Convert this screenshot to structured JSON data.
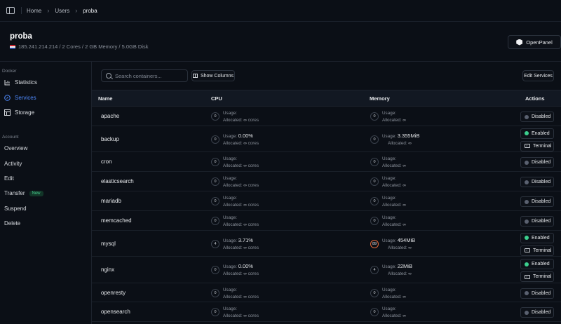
{
  "breadcrumb": [
    "Home",
    "Users",
    "proba"
  ],
  "server": {
    "name": "proba",
    "meta": "185.241.214.214 / 2 Cores / 2 GB Memory / 5.0GB Disk",
    "brand_button": "OpenPanel"
  },
  "sidebar": {
    "docker_section": "Docker",
    "docker_items": [
      {
        "label": "Statistics",
        "icon": "chart-icon"
      },
      {
        "label": "Services",
        "icon": "compass-icon",
        "active": true
      },
      {
        "label": "Storage",
        "icon": "table-icon"
      }
    ],
    "account_section": "Account",
    "account_items": [
      {
        "label": "Overview"
      },
      {
        "label": "Activity"
      },
      {
        "label": "Edit"
      },
      {
        "label": "Transfer",
        "badge": "New"
      },
      {
        "label": "Suspend"
      },
      {
        "label": "Delete"
      }
    ]
  },
  "toolbar": {
    "search_placeholder": "Search containers...",
    "show_columns": "Show Columns",
    "edit_services": "Edit Services"
  },
  "table": {
    "headers": {
      "name": "Name",
      "cpu": "CPU",
      "memory": "Memory",
      "actions": "Actions"
    },
    "usage_label": "Usage:",
    "allocated_label": "Allocated:",
    "cores_unit": "cores",
    "infinity": "∞",
    "rows": [
      {
        "name": "apache",
        "cpu_dial": "0",
        "cpu_usage": "",
        "mem_dial": "0",
        "mem_usage": "",
        "enabled": false
      },
      {
        "name": "backup",
        "cpu_dial": "0",
        "cpu_usage": "0.00%",
        "mem_dial": "0",
        "mem_usage": "3.355MiB",
        "enabled": true
      },
      {
        "name": "cron",
        "cpu_dial": "0",
        "cpu_usage": "",
        "mem_dial": "0",
        "mem_usage": "",
        "enabled": false
      },
      {
        "name": "elasticsearch",
        "cpu_dial": "0",
        "cpu_usage": "",
        "mem_dial": "0",
        "mem_usage": "",
        "enabled": false
      },
      {
        "name": "mariadb",
        "cpu_dial": "0",
        "cpu_usage": "",
        "mem_dial": "0",
        "mem_usage": "",
        "enabled": false
      },
      {
        "name": "memcached",
        "cpu_dial": "0",
        "cpu_usage": "",
        "mem_dial": "0",
        "mem_usage": "",
        "enabled": false
      },
      {
        "name": "mysql",
        "cpu_dial": "4",
        "cpu_usage": "3.71%",
        "mem_dial": "89",
        "mem_usage": "454MiB",
        "enabled": true
      },
      {
        "name": "nginx",
        "cpu_dial": "0",
        "cpu_usage": "0.00%",
        "mem_dial": "4",
        "mem_usage": "22MiB",
        "enabled": true
      },
      {
        "name": "openresty",
        "cpu_dial": "0",
        "cpu_usage": "",
        "mem_dial": "0",
        "mem_usage": "",
        "enabled": false
      },
      {
        "name": "opensearch",
        "cpu_dial": "0",
        "cpu_usage": "",
        "mem_dial": "0",
        "mem_usage": "",
        "enabled": false
      }
    ],
    "status_enabled": "Enabled",
    "status_disabled": "Disabled",
    "terminal_label": "Terminal"
  },
  "colors": {
    "background": "#0b0f16",
    "accent": "#4f8bff",
    "enabled": "#3ccf8e",
    "high_usage": "#e0673a",
    "new_badge": "#46c88a"
  }
}
